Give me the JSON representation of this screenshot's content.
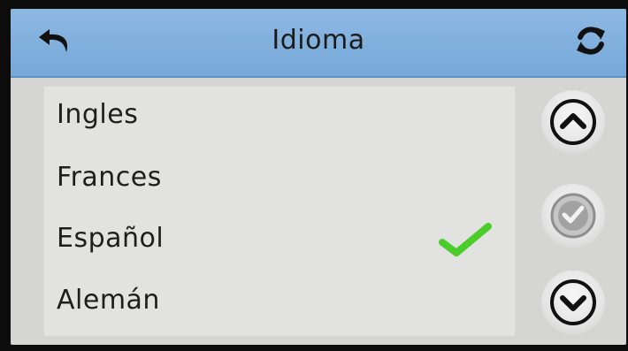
{
  "header": {
    "title": "Idioma",
    "back_icon": "back-arrow-icon",
    "refresh_icon": "refresh-icon"
  },
  "languages": [
    {
      "label": "Ingles",
      "selected": false
    },
    {
      "label": "Frances",
      "selected": false
    },
    {
      "label": "Español",
      "selected": true
    },
    {
      "label": "Alemán",
      "selected": false
    }
  ],
  "side_buttons": {
    "up_icon": "chevron-up-icon",
    "confirm_icon": "checkmark-circle-icon",
    "down_icon": "chevron-down-icon"
  },
  "colors": {
    "header": "#76a8d8",
    "check": "#4ccc2a",
    "background": "#d5d6d4"
  }
}
